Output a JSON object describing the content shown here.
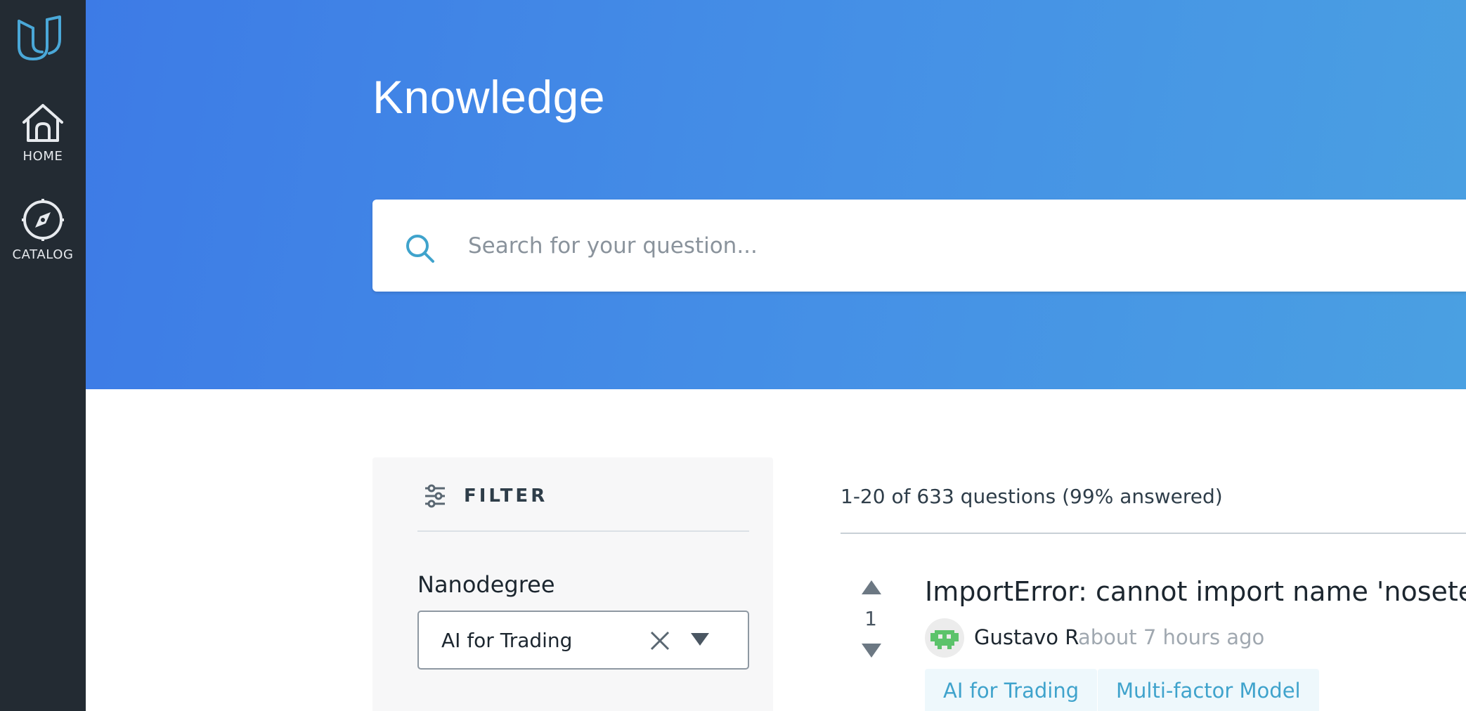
{
  "sidebar": {
    "logo_icon": "udacity-logo-icon",
    "items": [
      {
        "label": "HOME",
        "icon": "home-icon"
      },
      {
        "label": "CATALOG",
        "icon": "compass-icon"
      }
    ]
  },
  "hero": {
    "title": "Knowledge",
    "search_placeholder": "Search for your question..."
  },
  "filter": {
    "title": "FILTER",
    "nanodegree_label": "Nanodegree",
    "nanodegree_value": "AI for Trading"
  },
  "results": {
    "count_text": "1-20 of 633 questions (99% answered)",
    "questions": [
      {
        "votes": "1",
        "title": "ImportError: cannot import name 'noseteste",
        "author": "Gustavo R",
        "time": "about 7 hours ago",
        "tags": [
          "AI for Trading",
          "Multi-factor Model"
        ]
      }
    ]
  },
  "colors": {
    "sidebar_bg": "#232b33",
    "hero_start": "#3d7be6",
    "hero_end": "#4aa0e2",
    "accent": "#3fa3cc",
    "tag_bg": "#eef8fc"
  }
}
